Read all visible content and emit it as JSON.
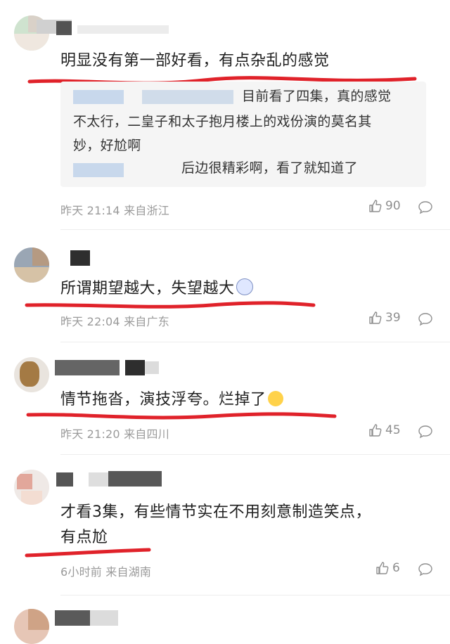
{
  "comments": [
    {
      "text": "明显没有第一部好看，有点杂乱的感觉",
      "replies": [
        {
          "line1": "目前看了四集，真的感觉",
          "line2": "不太行，二皇子和太子抱月楼上的戏份演的莫名其",
          "line3": "妙，好尬啊"
        },
        {
          "line1": "后边很精彩啊，看了就知道了"
        }
      ],
      "time": "昨天 21:14",
      "location": "来自浙江",
      "likes": "90"
    },
    {
      "text": "所谓期望越大，失望越大",
      "emoji": "shocked-face-emoji",
      "time": "昨天 22:04",
      "location": "来自广东",
      "likes": "39"
    },
    {
      "text": "情节拖沓，演技浮夸。烂掉了",
      "emoji": "face-emoji",
      "time": "昨天 21:20",
      "location": "来自四川",
      "likes": "45"
    },
    {
      "text_line1": "才看3集，有些情节实在不用刻意制造笑点，",
      "text_line2": "有点尬",
      "time": "6小时前",
      "location": "来自湖南",
      "likes": "6"
    }
  ],
  "colors": {
    "underline": "#e0222a",
    "meta": "#9a9a9a",
    "reply_bg": "#f5f5f5"
  }
}
